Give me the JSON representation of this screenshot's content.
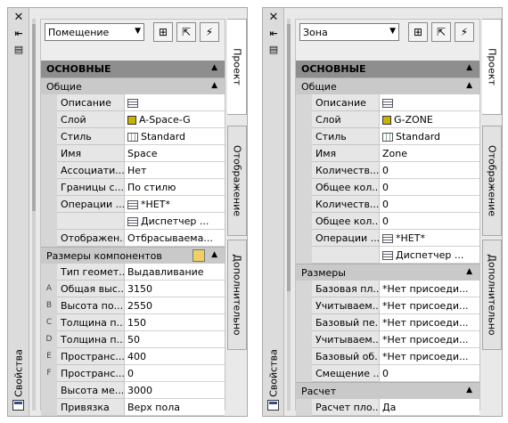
{
  "left": {
    "sidebar_title": "Свойства",
    "dropdown_value": "Помещение",
    "tabs": [
      "Проект",
      "Отображение",
      "Дополнительно"
    ],
    "section_main": "ОСНОВНЫЕ",
    "section_general": "Общие",
    "general_rows": [
      {
        "name": "Описание",
        "value": "",
        "icon": "list"
      },
      {
        "name": "Слой",
        "value": "A-Space-G",
        "icon": "sq"
      },
      {
        "name": "Стиль",
        "value": "Standard",
        "icon": "grid"
      },
      {
        "name": "Имя",
        "value": "Space",
        "icon": ""
      },
      {
        "name": "Ассоциати...",
        "value": "Нет",
        "icon": ""
      },
      {
        "name": "Границы с...",
        "value": "По стилю",
        "icon": ""
      },
      {
        "name": "Операции ...",
        "value": "*НЕТ*",
        "icon": "list"
      },
      {
        "name": "",
        "value": "Диспетчер ...",
        "icon": "list"
      },
      {
        "name": "Отображен...",
        "value": "Отбрасываема...",
        "icon": ""
      }
    ],
    "section_dims": "Размеры компонентов",
    "dim_rows": [
      {
        "letter": "",
        "name": "Тип геомет...",
        "value": "Выдавливание"
      },
      {
        "letter": "A",
        "name": "Общая выс...",
        "value": "3150"
      },
      {
        "letter": "B",
        "name": "Высота по...",
        "value": "2550"
      },
      {
        "letter": "C",
        "name": "Толщина п...",
        "value": "150"
      },
      {
        "letter": "D",
        "name": "Толщина п...",
        "value": "50"
      },
      {
        "letter": "E",
        "name": "Пространс...",
        "value": "400"
      },
      {
        "letter": "F",
        "name": "Пространс...",
        "value": "0"
      },
      {
        "letter": "",
        "name": "Высота ме...",
        "value": "3000"
      },
      {
        "letter": "",
        "name": "Привязка",
        "value": "Верх пола"
      }
    ]
  },
  "right": {
    "sidebar_title": "Свойства",
    "dropdown_value": "Зона",
    "tabs": [
      "Проект",
      "Отображение",
      "Дополнительно"
    ],
    "section_main": "ОСНОВНЫЕ",
    "section_general": "Общие",
    "general_rows": [
      {
        "name": "Описание",
        "value": "",
        "icon": "list"
      },
      {
        "name": "Слой",
        "value": "G-ZONE",
        "icon": "sq"
      },
      {
        "name": "Стиль",
        "value": "Standard",
        "icon": "grid"
      },
      {
        "name": "Имя",
        "value": "Zone",
        "icon": ""
      },
      {
        "name": "Количеств...",
        "value": "0",
        "icon": ""
      },
      {
        "name": "Общее кол...",
        "value": "0",
        "icon": ""
      },
      {
        "name": "Количеств...",
        "value": "0",
        "icon": ""
      },
      {
        "name": "Общее кол...",
        "value": "0",
        "icon": ""
      },
      {
        "name": "Операции ...",
        "value": "*НЕТ*",
        "icon": "list"
      },
      {
        "name": "",
        "value": "Диспетчер ...",
        "icon": "list"
      }
    ],
    "section_dims": "Размеры",
    "dim_rows": [
      {
        "letter": "",
        "name": "Базовая пл...",
        "value": "*Нет присоеди..."
      },
      {
        "letter": "",
        "name": "Учитываем...",
        "value": "*Нет присоеди..."
      },
      {
        "letter": "",
        "name": "Базовый пе...",
        "value": "*Нет присоеди..."
      },
      {
        "letter": "",
        "name": "Учитываем...",
        "value": "*Нет присоеди..."
      },
      {
        "letter": "",
        "name": "Базовый об...",
        "value": "*Нет присоеди..."
      },
      {
        "letter": "",
        "name": "Смещение ...",
        "value": "0"
      }
    ],
    "section_calc": "Расчет",
    "calc_rows": [
      {
        "letter": "",
        "name": "Расчет пло...",
        "value": "Да"
      }
    ]
  }
}
